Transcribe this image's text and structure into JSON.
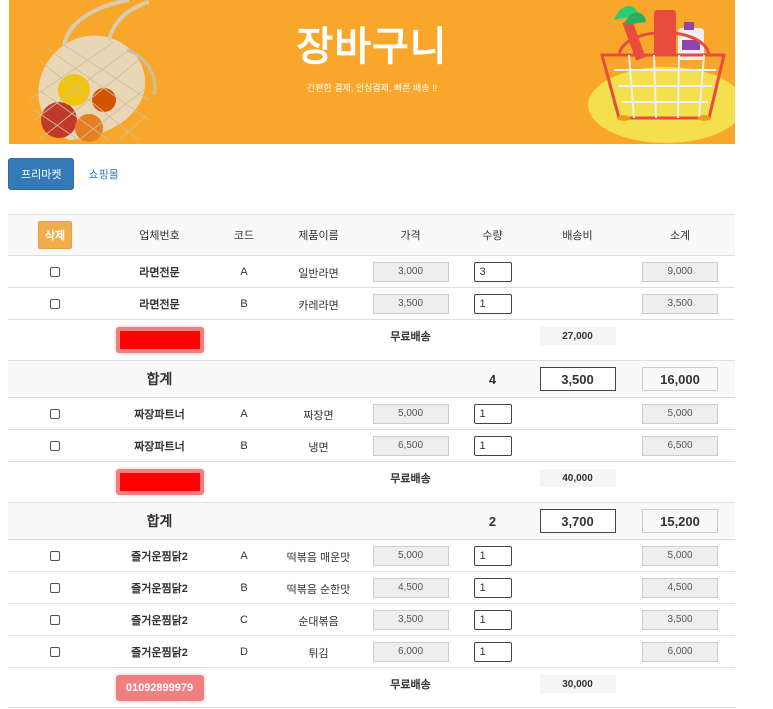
{
  "banner": {
    "title": "장바구니",
    "subtitle": "간편한 결제, 안심결제, 빠른 배송 !!",
    "background": "#f9a72b"
  },
  "tabs": {
    "active": "프리마켓",
    "other": "쇼핑몰"
  },
  "table": {
    "headers": {
      "delete": "삭제",
      "vendor": "업체번호",
      "code": "코드",
      "name": "제품이름",
      "price": "가격",
      "qty": "수량",
      "shipping": "배송비",
      "subtotal": "소계"
    },
    "groups": [
      {
        "items": [
          {
            "vendor": "라면전문",
            "code": "A",
            "name": "일반라면",
            "price": "3,000",
            "qty": "3",
            "subtotal": "9,000"
          },
          {
            "vendor": "라면전문",
            "code": "B",
            "name": "카레라면",
            "price": "3,500",
            "qty": "1",
            "subtotal": "3,500"
          }
        ],
        "phone": "",
        "free_shipping": "무료배송",
        "shipping_threshold": "27,000",
        "total": {
          "label": "합계",
          "qty": "4",
          "price": "3,500",
          "subtotal": "16,000"
        }
      },
      {
        "items": [
          {
            "vendor": "짜장파트너",
            "code": "A",
            "name": "짜장면",
            "price": "5,000",
            "qty": "1",
            "subtotal": "5,000"
          },
          {
            "vendor": "짜장파트너",
            "code": "B",
            "name": "냉면",
            "price": "6,500",
            "qty": "1",
            "subtotal": "6,500"
          }
        ],
        "phone": "",
        "free_shipping": "무료배송",
        "shipping_threshold": "40,000",
        "total": {
          "label": "합계",
          "qty": "2",
          "price": "3,700",
          "subtotal": "15,200"
        }
      },
      {
        "items": [
          {
            "vendor": "즐거운찜닭2",
            "code": "A",
            "name": "떡볶음 매운맛",
            "price": "5,000",
            "qty": "1",
            "subtotal": "5,000"
          },
          {
            "vendor": "즐거운찜닭2",
            "code": "B",
            "name": "떡볶음 순한맛",
            "price": "4,500",
            "qty": "1",
            "subtotal": "4,500"
          },
          {
            "vendor": "즐거운찜닭2",
            "code": "C",
            "name": "순대볶음",
            "price": "3,500",
            "qty": "1",
            "subtotal": "3,500"
          },
          {
            "vendor": "즐거운찜닭2",
            "code": "D",
            "name": "튀김",
            "price": "6,000",
            "qty": "1",
            "subtotal": "6,000"
          }
        ],
        "phone": "01092899979",
        "free_shipping": "무료배송",
        "shipping_threshold": "30,000"
      }
    ]
  },
  "colors": {
    "primary": "#337ab7",
    "warning": "#f0ad4e",
    "phone_badge": "#f08080",
    "redaction": "#ff0000"
  }
}
